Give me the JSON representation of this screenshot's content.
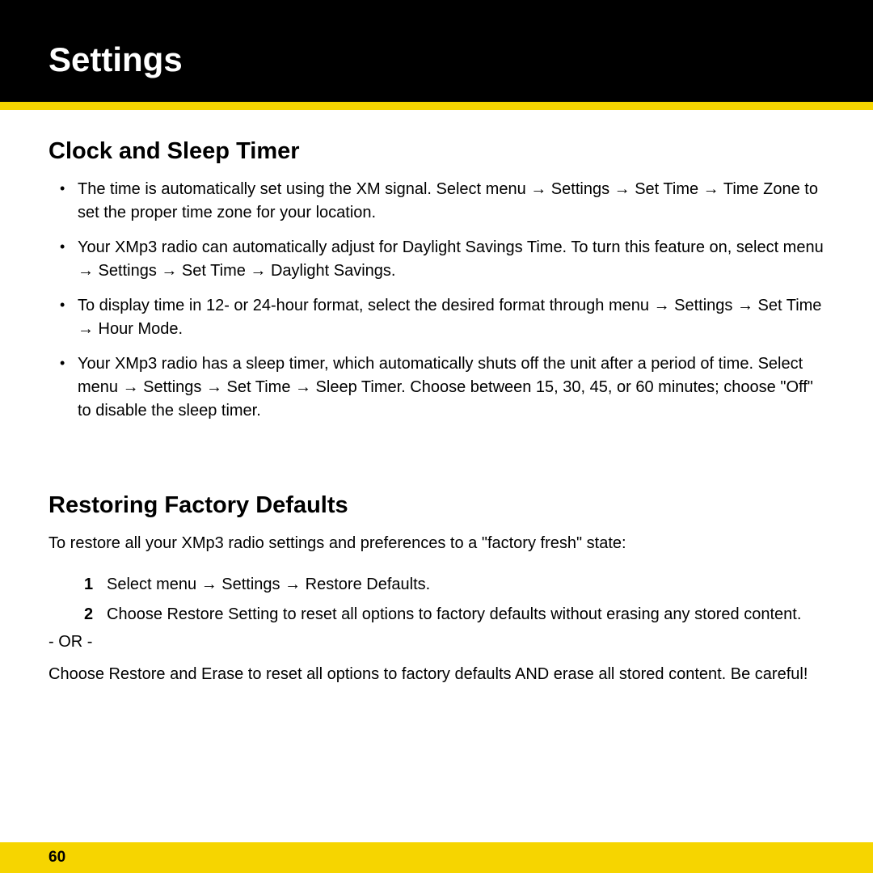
{
  "header": {
    "title": "Settings"
  },
  "section1": {
    "heading": "Clock and Sleep Timer",
    "bullets": [
      "The time is automatically set using the XM signal. Select menu → Settings → Set Time → Time Zone to set the proper time zone for your location.",
      "Your XMp3 radio can automatically adjust for Daylight Savings Time. To turn this feature on, select menu → Settings → Set Time → Daylight Savings.",
      "To display time in 12- or 24-hour format, select the desired format through menu → Settings → Set Time → Hour Mode.",
      "Your XMp3 radio has a sleep timer, which automatically shuts off the unit after a period of time. Select menu → Settings → Set Time → Sleep Timer. Choose between 15, 30, 45, or 60 minutes; choose \"Off\" to disable the sleep timer."
    ]
  },
  "section2": {
    "heading": "Restoring Factory Defaults",
    "intro": "To restore all your XMp3 radio settings and preferences to a \"factory fresh\" state:",
    "steps": [
      "Select menu → Settings → Restore Defaults.",
      "Choose Restore Setting to reset all options to factory defaults without erasing any stored content."
    ],
    "or": "- OR -",
    "para": "Choose Restore and Erase to reset all options to factory defaults AND erase all stored content. Be careful!"
  },
  "footer": {
    "page": "60"
  }
}
